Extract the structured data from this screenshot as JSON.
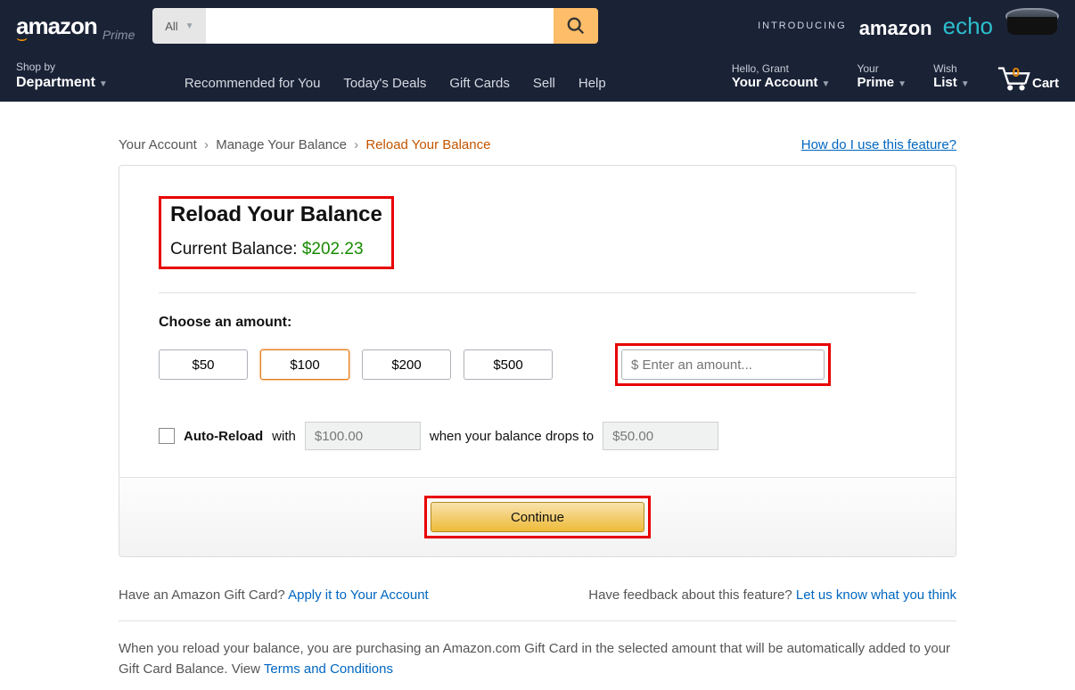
{
  "header": {
    "logo_prime": "Prime",
    "search_all": "All",
    "promo_intro": "INTRODUCING",
    "promo_amazon": "amazon",
    "promo_echo": "echo",
    "dept_small": "Shop by",
    "dept_big": "Department",
    "nav": [
      "Recommended for You",
      "Today's Deals",
      "Gift Cards",
      "Sell",
      "Help"
    ],
    "hello": "Hello, Grant",
    "your_account": "Your Account",
    "your": "Your",
    "prime": "Prime",
    "wish": "Wish",
    "list": "List",
    "cart_count": "0",
    "cart_label": "Cart"
  },
  "breadcrumbs": {
    "a": "Your Account",
    "b": "Manage Your Balance",
    "c": "Reload Your Balance",
    "help": "How do I use this feature?"
  },
  "panel": {
    "title": "Reload Your Balance",
    "balance_label": "Current Balance: ",
    "balance_value": "$202.23",
    "choose_label": "Choose an amount:",
    "amounts": [
      "$50",
      "$100",
      "$200",
      "$500"
    ],
    "selected_index": 1,
    "custom_placeholder": "$ Enter an amount...",
    "auto_label": "Auto-Reload",
    "with": "with",
    "auto_amount": "$100.00",
    "when": "when your balance drops to",
    "auto_threshold": "$50.00",
    "continue": "Continue"
  },
  "footer": {
    "gc_q": "Have an Amazon Gift Card? ",
    "gc_link": "Apply it to Your Account",
    "fb_q": "Have feedback about this feature? ",
    "fb_link": "Let us know what you think",
    "legal_a": "When you reload your balance, you are purchasing an Amazon.com Gift Card in the selected amount that will be automatically added to your Gift Card Balance. View ",
    "legal_link": "Terms and Conditions"
  }
}
